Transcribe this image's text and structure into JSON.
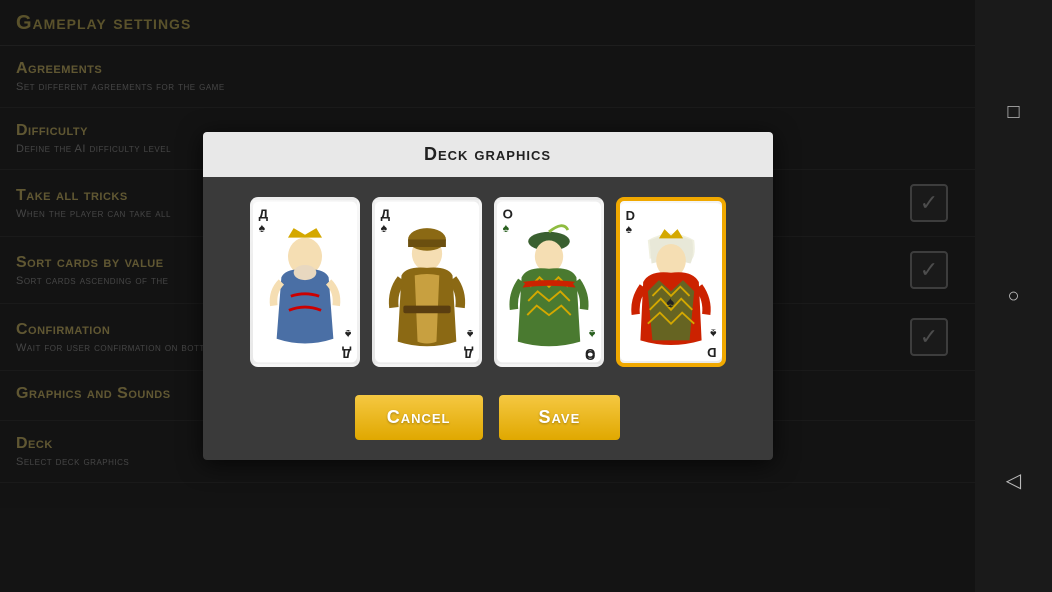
{
  "page": {
    "title": "Gameplay settings"
  },
  "settings": [
    {
      "id": "agreements",
      "title": "Agreements",
      "desc": "Set different agreements for the game",
      "hasCheckbox": false
    },
    {
      "id": "difficulty",
      "title": "Difficulty",
      "desc": "Define the AI difficulty level",
      "hasCheckbox": false
    },
    {
      "id": "take-all-tricks",
      "title": "Take all tricks",
      "desc": "When the player can take all",
      "hasCheckbox": true,
      "checked": true
    },
    {
      "id": "sort-cards",
      "title": "Sort cards by value",
      "desc": "Sort cards ascending of the",
      "hasCheckbox": true,
      "checked": true
    },
    {
      "id": "confirmation",
      "title": "Confirmation",
      "desc": "Wait for user confirmation on bottom",
      "hasCheckbox": true,
      "checked": true
    },
    {
      "id": "graphics-sounds",
      "title": "Graphics and Sounds",
      "desc": "",
      "hasCheckbox": false
    },
    {
      "id": "deck",
      "title": "Deck",
      "desc": "Select deck graphics",
      "hasCheckbox": false
    }
  ],
  "modal": {
    "title": "Deck graphics",
    "cards": [
      {
        "id": "card-1",
        "label": "Д",
        "suit": "♠",
        "selected": false
      },
      {
        "id": "card-2",
        "label": "Д",
        "suit": "♠",
        "selected": false
      },
      {
        "id": "card-3",
        "label": "О",
        "suit": "♠",
        "selected": false
      },
      {
        "id": "card-4",
        "label": "D",
        "suit": "♠",
        "selected": true
      }
    ],
    "cancel_label": "Cancel",
    "save_label": "Save"
  },
  "sidebar": {
    "buttons": [
      "□",
      "○",
      "◁"
    ]
  }
}
